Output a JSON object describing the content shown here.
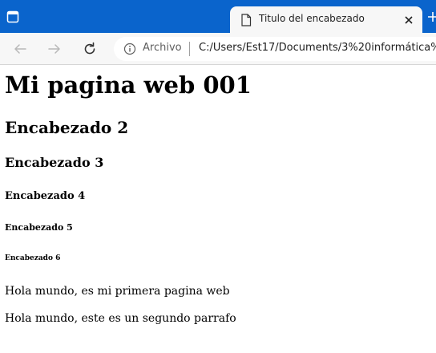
{
  "browser": {
    "tab": {
      "title": "Titulo del encabezado"
    },
    "address_bar": {
      "scheme_label": "Archivo",
      "url": "C:/Users/Est17/Documents/3%20informática%2"
    }
  },
  "page": {
    "h1": "Mi pagina web 001",
    "h2": "Encabezado 2",
    "h3": "Encabezado 3",
    "h4": "Encabezado 4",
    "h5": "Encabezado 5",
    "h6": "Encabezado 6",
    "paragraphs": [
      "Hola mundo, es mi primera pagina web",
      "Hola mundo, este es un segundo parrafo"
    ]
  },
  "colors": {
    "titlebar": "#0a64cc",
    "toolbar": "#f7f7f7",
    "page_background": "#ffffff"
  },
  "icons": {
    "window_menu": "tab-actions-icon",
    "favicon": "document-icon",
    "close": "close-icon",
    "new_tab": "plus-icon",
    "back": "arrow-left-icon",
    "forward": "arrow-right-icon",
    "reload": "refresh-icon",
    "info": "info-icon"
  }
}
